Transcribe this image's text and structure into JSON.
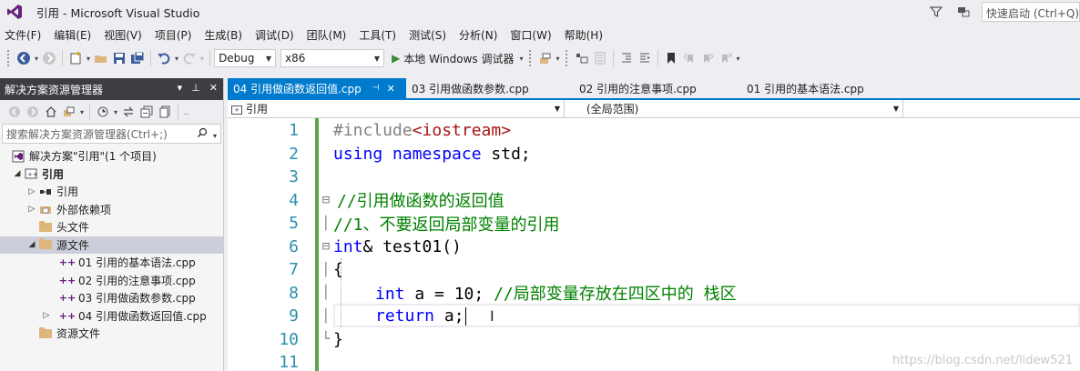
{
  "window": {
    "title": "引用 - Microsoft Visual Studio",
    "quick_launch_placeholder": "快速启动 (Ctrl+Q)"
  },
  "menu": [
    "文件(F)",
    "编辑(E)",
    "视图(V)",
    "项目(P)",
    "生成(B)",
    "调试(D)",
    "团队(M)",
    "工具(T)",
    "测试(S)",
    "分析(N)",
    "窗口(W)",
    "帮助(H)"
  ],
  "toolbar": {
    "config": "Debug",
    "platform": "x86",
    "run_label": "本地 Windows 调试器"
  },
  "solution_explorer": {
    "title": "解决方案资源管理器",
    "search_placeholder": "搜索解决方案资源管理器(Ctrl+;)",
    "tree": [
      {
        "label": "解决方案\"引用\"(1 个项目)",
        "icon": "solution-icon"
      },
      {
        "label": "引用",
        "icon": "project-icon"
      },
      {
        "label": "引用",
        "icon": "references-icon"
      },
      {
        "label": "外部依赖项",
        "icon": "external-deps-icon"
      },
      {
        "label": "头文件",
        "icon": "folder-icon"
      },
      {
        "label": "源文件",
        "icon": "folder-icon"
      },
      {
        "label": "01 引用的基本语法.cpp",
        "icon": "cpp-file-icon"
      },
      {
        "label": "02 引用的注意事项.cpp",
        "icon": "cpp-file-icon"
      },
      {
        "label": "03 引用做函数参数.cpp",
        "icon": "cpp-file-icon"
      },
      {
        "label": "04 引用做函数返回值.cpp",
        "icon": "cpp-file-icon"
      },
      {
        "label": "资源文件",
        "icon": "folder-icon"
      }
    ]
  },
  "tabs": [
    {
      "label": "04 引用做函数返回值.cpp",
      "active": true
    },
    {
      "label": "03 引用做函数参数.cpp",
      "active": false
    },
    {
      "label": "02 引用的注意事项.cpp",
      "active": false
    },
    {
      "label": "01 引用的基本语法.cpp",
      "active": false
    }
  ],
  "navbar": {
    "project": "引用",
    "scope": "(全局范围)"
  },
  "code": {
    "line_numbers": [
      "1",
      "2",
      "3",
      "4",
      "5",
      "6",
      "7",
      "8",
      "9",
      "10",
      "11"
    ],
    "l1_pp": "#include",
    "l1_inc": "<iostream>",
    "l2_kw1": "using",
    "l2_kw2": "namespace",
    "l2_rest": " std;",
    "l4_cm": "//引用做函数的返回值",
    "l5_cm": "//1、不要返回局部变量的引用",
    "l6_kw": "int",
    "l6_rest": "& test01()",
    "l7": "{",
    "l8_kw": "int",
    "l8_rest": " a = 10; ",
    "l8_cm": "//局部变量存放在四区中的 栈区",
    "l9_kw": "return",
    "l9_rest": " a;",
    "l10": "}"
  },
  "watermark": "https://blog.csdn.net/lidew521"
}
